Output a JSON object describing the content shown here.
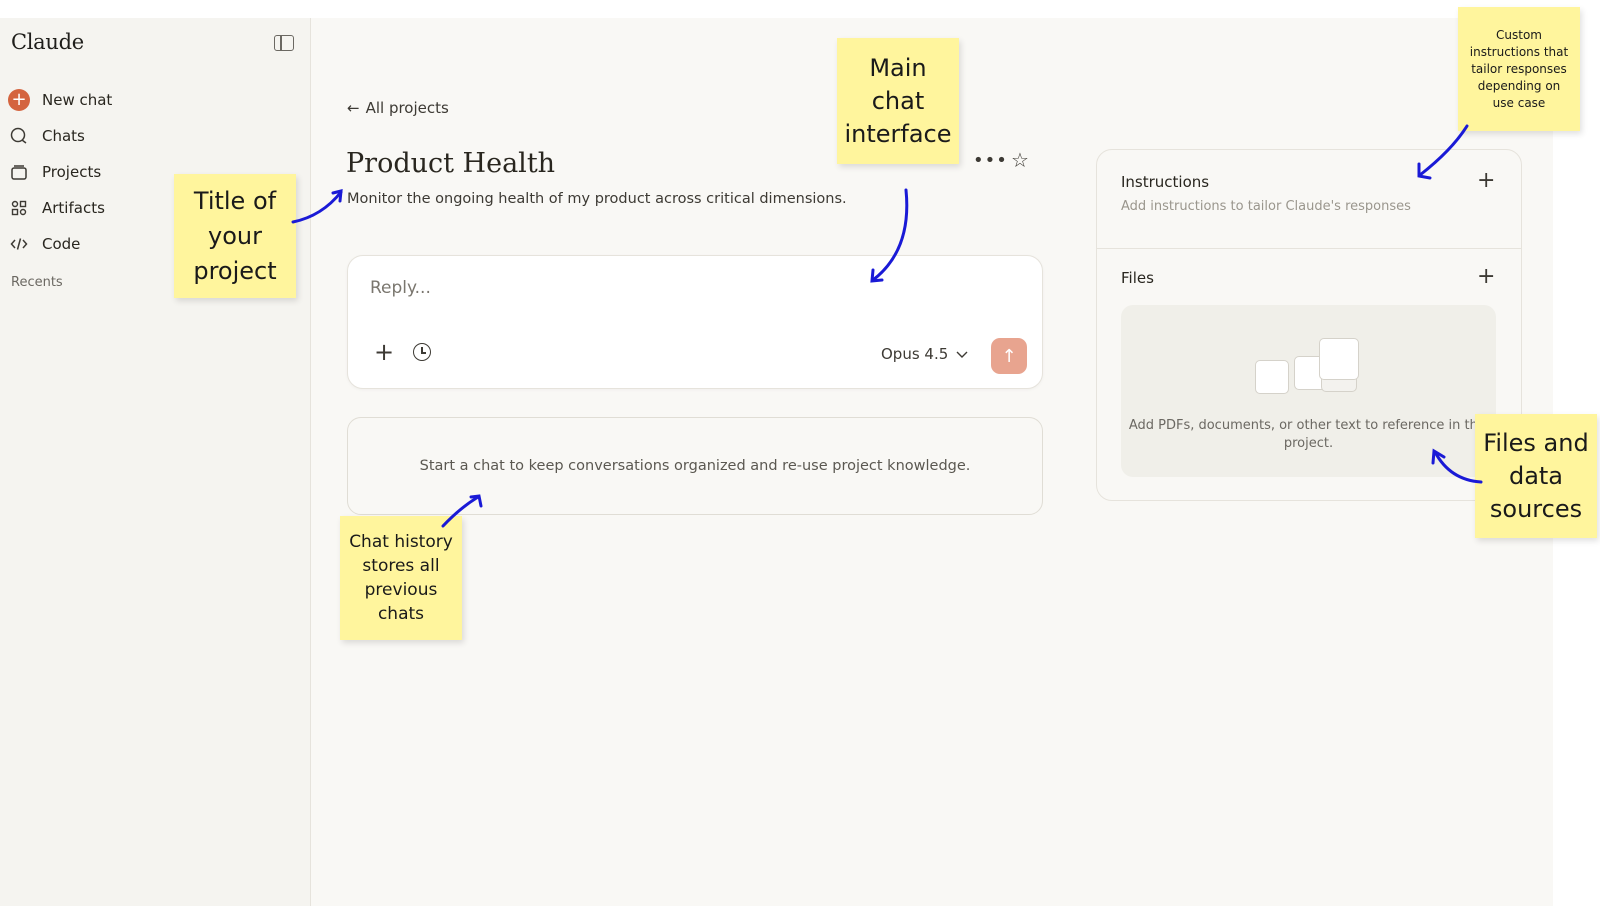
{
  "sidebar": {
    "logo": "Claude",
    "items": [
      {
        "label": "New chat",
        "icon": "plus-icon"
      },
      {
        "label": "Chats",
        "icon": "chat-icon"
      },
      {
        "label": "Projects",
        "icon": "folder-icon"
      },
      {
        "label": "Artifacts",
        "icon": "artifacts-icon"
      },
      {
        "label": "Code",
        "icon": "code-icon"
      }
    ],
    "recents_label": "Recents"
  },
  "main": {
    "back_label": "All projects",
    "project_title": "Product Health",
    "project_description": "Monitor the ongoing health of my product across critical dimensions.",
    "composer": {
      "placeholder": "Reply...",
      "model": "Opus 4.5"
    },
    "history_empty_text": "Start a chat to keep conversations organized and re-use project knowledge."
  },
  "panel": {
    "instructions_title": "Instructions",
    "instructions_sub": "Add instructions to tailor Claude's responses",
    "files_title": "Files",
    "files_text": "Add PDFs, documents, or other text to reference in this project."
  },
  "annotations": {
    "main_chat": "Main\nchat\ninterface",
    "title": "Title of\nyour\nproject",
    "history": "Chat history\nstores all\nprevious\nchats",
    "instructions": "Custom\ninstructions that\ntailor responses\ndepending on\nuse case",
    "files": "Files and\ndata\nsources"
  },
  "colors": {
    "accent": "#d4643f",
    "send_button": "#e8a48f",
    "sticky_note": "#fff59d",
    "annotation_arrow": "#1a1ad6"
  }
}
